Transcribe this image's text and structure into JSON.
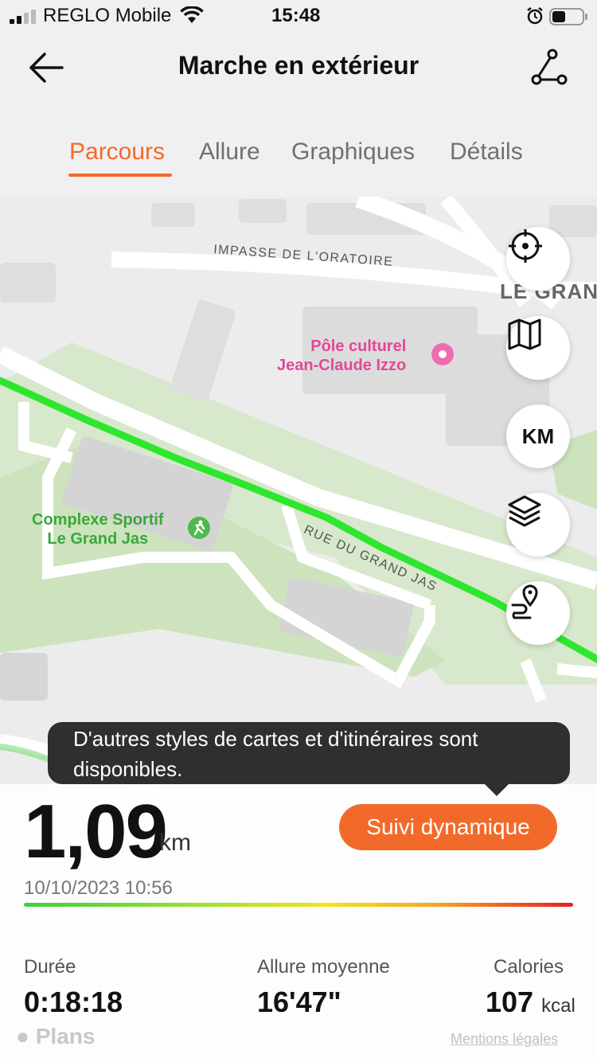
{
  "status_bar": {
    "carrier": "REGLO Mobile",
    "time": "15:48",
    "icons": [
      "signal-icon",
      "wifi-icon",
      "alarm-icon",
      "battery-icon"
    ]
  },
  "header": {
    "title": "Marche en extérieur",
    "back_icon": "arrow-left-icon",
    "route_icon": "route-nodes-icon"
  },
  "tabs": [
    {
      "label": "Parcours",
      "active": true
    },
    {
      "label": "Allure",
      "active": false
    },
    {
      "label": "Graphiques",
      "active": false
    },
    {
      "label": "Détails",
      "active": false
    }
  ],
  "map": {
    "street_labels": [
      "IMPASSE DE L'ORATOIRE",
      "RUE DU GRAND JAS",
      "LE GRAND"
    ],
    "poi_culture": {
      "line1": "Pôle culturel",
      "line2": "Jean-Claude Izzo"
    },
    "poi_sport": {
      "line1": "Complexe Sportif",
      "line2": "Le Grand Jas"
    },
    "controls": [
      {
        "name": "locate-button",
        "icon": "crosshair-icon"
      },
      {
        "name": "map-style-button",
        "icon": "map-icon"
      },
      {
        "name": "km-markers-button",
        "label": "KM"
      },
      {
        "name": "layers-button",
        "icon": "layers-icon"
      },
      {
        "name": "route-pin-button",
        "icon": "route-pin-icon"
      }
    ],
    "route_color": "#2ee62e"
  },
  "tooltip": {
    "text": "D'autres styles de cartes et d'itinéraires sont disponibles."
  },
  "summary": {
    "distance": "1,09",
    "distance_unit": "km",
    "date": "10/10/2023 10:56",
    "dynamic_button": "Suivi dynamique",
    "accent_color": "#f26a2a",
    "stats": [
      {
        "label": "Durée",
        "value": "0:18:18",
        "unit": ""
      },
      {
        "label": "Allure moyenne",
        "value": "16'47\"",
        "unit": ""
      },
      {
        "label": "Calories",
        "value": "107",
        "unit": "kcal"
      }
    ]
  },
  "footer": {
    "maps_brand": "Plans",
    "legal_link": "Mentions légales"
  }
}
